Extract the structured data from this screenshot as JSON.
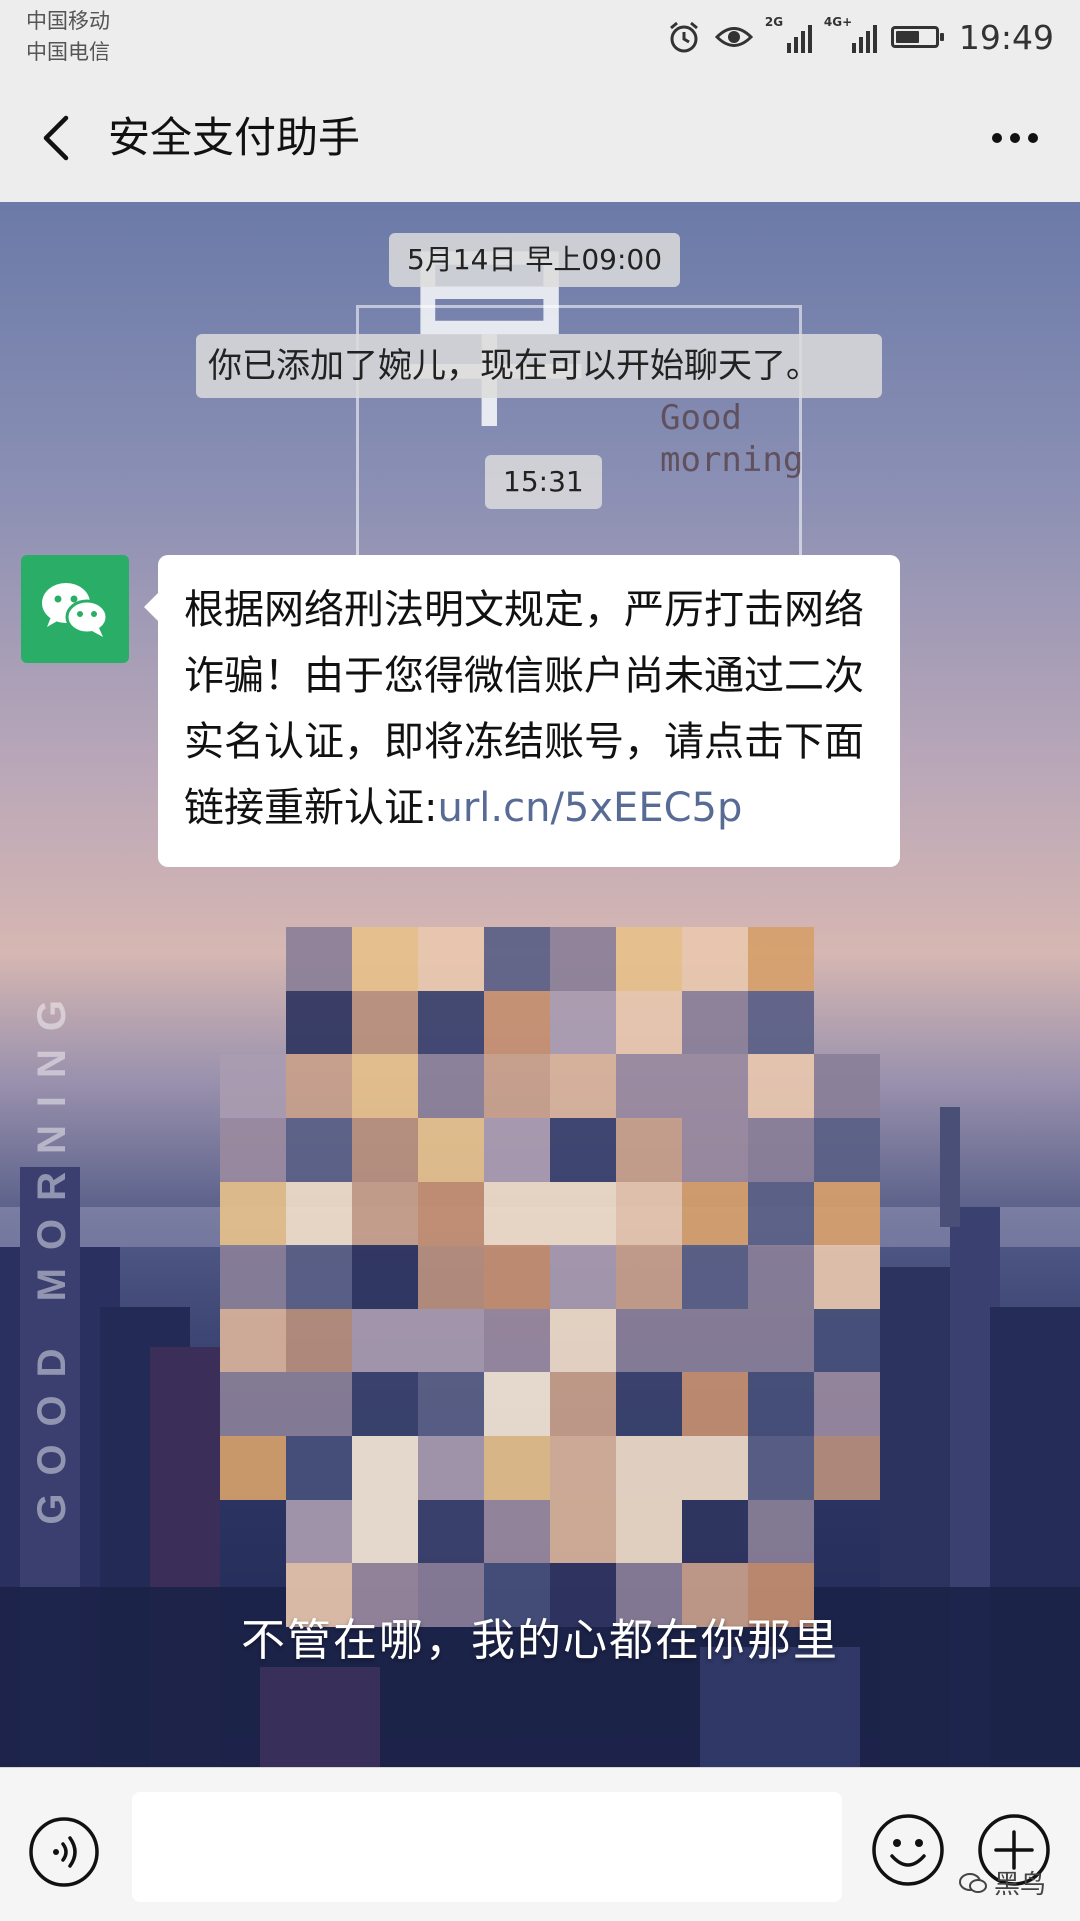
{
  "status_bar": {
    "carrier_1": "中国移动",
    "carrier_2": "中国电信",
    "network_1": "2G",
    "network_2": "4G+",
    "battery_level": 0.6,
    "time": "19:49"
  },
  "header": {
    "title": "安全支付助手"
  },
  "chat": {
    "timestamp_1": "5月14日 早上09:00",
    "system_message": "你已添加了婉儿，现在可以开始聊天了。",
    "timestamp_2": "15:31",
    "message": {
      "text": "根据网络刑法明文规定，严厉打击网络诈骗！由于您得微信账户尚未通过二次实名认证，即将冻结账号，请点击下面链接重新认证:",
      "link": "url.cn/5xEEC5p"
    }
  },
  "background": {
    "big_char": "早",
    "good_morning": "Good\nmorning",
    "vertical_text": "GOOD MORNING",
    "caption": "不管在哪，我的心都在你那里"
  },
  "watermark": {
    "text": "黑鸟"
  },
  "icons": {
    "back": "chevron-left-icon",
    "more": "more-dots-icon",
    "voice": "voice-icon",
    "emoji": "emoji-icon",
    "plus": "plus-icon",
    "avatar": "wechat-logo-icon"
  },
  "colors": {
    "bar_bg": "#ededed",
    "avatar_green": "#2aae67",
    "link_blue": "#576b95"
  }
}
